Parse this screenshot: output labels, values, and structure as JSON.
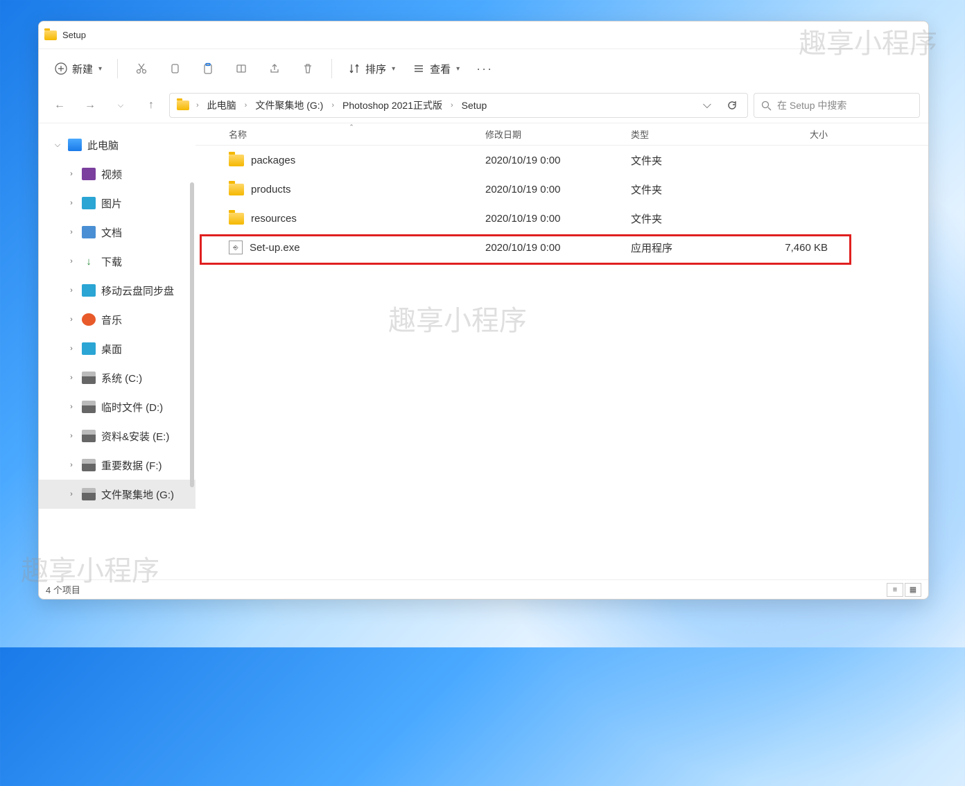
{
  "watermark": "趣享小程序",
  "window_title": "Setup",
  "toolbar": {
    "new_label": "新建",
    "sort_label": "排序",
    "view_label": "查看"
  },
  "breadcrumb": [
    "此电脑",
    "文件聚集地 (G:)",
    "Photoshop 2021正式版",
    "Setup"
  ],
  "search_placeholder": "在 Setup 中搜索",
  "columns": {
    "name": "名称",
    "date": "修改日期",
    "type": "类型",
    "size": "大小"
  },
  "files": [
    {
      "icon": "folder",
      "name": "packages",
      "date": "2020/10/19 0:00",
      "type": "文件夹",
      "size": ""
    },
    {
      "icon": "folder",
      "name": "products",
      "date": "2020/10/19 0:00",
      "type": "文件夹",
      "size": ""
    },
    {
      "icon": "folder",
      "name": "resources",
      "date": "2020/10/19 0:00",
      "type": "文件夹",
      "size": ""
    },
    {
      "icon": "exe",
      "name": "Set-up.exe",
      "date": "2020/10/19 0:00",
      "type": "应用程序",
      "size": "7,460 KB"
    }
  ],
  "sidebar": [
    {
      "label": "此电脑",
      "icon": "pc",
      "exp": "open",
      "level": 0
    },
    {
      "label": "视频",
      "icon": "video",
      "exp": "closed",
      "level": 1
    },
    {
      "label": "图片",
      "icon": "pic",
      "exp": "closed",
      "level": 1
    },
    {
      "label": "文档",
      "icon": "doc",
      "exp": "closed",
      "level": 1
    },
    {
      "label": "下载",
      "icon": "dl",
      "exp": "closed",
      "level": 1
    },
    {
      "label": "移动云盘同步盘",
      "icon": "cloud",
      "exp": "closed",
      "level": 1
    },
    {
      "label": "音乐",
      "icon": "music",
      "exp": "closed",
      "level": 1
    },
    {
      "label": "桌面",
      "icon": "desk",
      "exp": "closed",
      "level": 1
    },
    {
      "label": "系统 (C:)",
      "icon": "drive",
      "exp": "closed",
      "level": 1
    },
    {
      "label": "临时文件 (D:)",
      "icon": "drive",
      "exp": "closed",
      "level": 1
    },
    {
      "label": "资料&安装 (E:)",
      "icon": "drive",
      "exp": "closed",
      "level": 1
    },
    {
      "label": "重要数据 (F:)",
      "icon": "drive",
      "exp": "closed",
      "level": 1
    },
    {
      "label": "文件聚集地 (G:)",
      "icon": "drive",
      "exp": "closed",
      "level": 1,
      "selected": true
    }
  ],
  "status": "4 个项目"
}
